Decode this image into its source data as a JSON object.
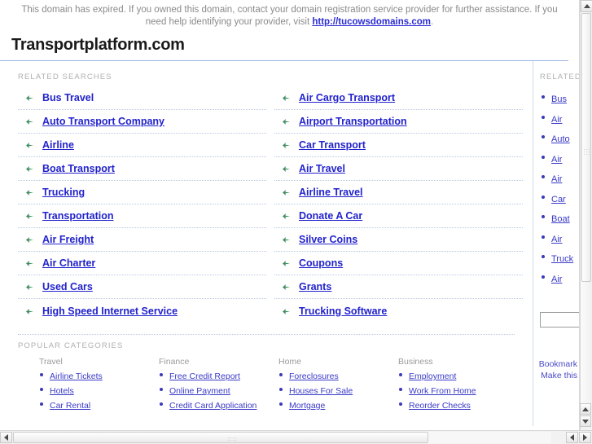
{
  "notice": {
    "text_before": "This domain has expired. If you owned this domain, contact your domain registration service provider for further assistance. If you need help identifying your provider, visit ",
    "link_text": "http://tucowsdomains.com",
    "text_after": "."
  },
  "header": {
    "domain_title": "Transportplatform.com"
  },
  "related_searches": {
    "label": "RELATED SEARCHES",
    "left_column": [
      {
        "label": "Bus Travel"
      },
      {
        "label": "Auto Transport Company"
      },
      {
        "label": "Airline"
      },
      {
        "label": "Boat Transport"
      },
      {
        "label": "Trucking"
      },
      {
        "label": "Transportation"
      },
      {
        "label": "Air Freight"
      },
      {
        "label": "Air Charter"
      },
      {
        "label": "Used Cars"
      },
      {
        "label": "High Speed Internet Service"
      }
    ],
    "right_column": [
      {
        "label": "Air Cargo Transport"
      },
      {
        "label": "Airport Transportation"
      },
      {
        "label": "Car Transport"
      },
      {
        "label": "Air Travel"
      },
      {
        "label": "Airline Travel"
      },
      {
        "label": "Donate A Car"
      },
      {
        "label": "Silver Coins"
      },
      {
        "label": "Coupons"
      },
      {
        "label": "Grants"
      },
      {
        "label": "Trucking Software"
      }
    ]
  },
  "popular_categories": {
    "label": "POPULAR CATEGORIES",
    "columns": [
      {
        "heading": "Travel",
        "items": [
          "Airline Tickets",
          "Hotels",
          "Car Rental"
        ]
      },
      {
        "heading": "Finance",
        "items": [
          "Free Credit Report",
          "Online Payment",
          "Credit Card Application"
        ]
      },
      {
        "heading": "Home",
        "items": [
          "Foreclosures",
          "Houses For Sale",
          "Mortgage"
        ]
      },
      {
        "heading": "Business",
        "items": [
          "Employment",
          "Work From Home",
          "Reorder Checks"
        ]
      }
    ]
  },
  "sidebar": {
    "label": "RELATED",
    "items": [
      {
        "label": "Bus"
      },
      {
        "label": "Air"
      },
      {
        "label": "Auto"
      },
      {
        "label": "Air"
      },
      {
        "label": "Air"
      },
      {
        "label": "Car"
      },
      {
        "label": "Boat"
      },
      {
        "label": "Air"
      },
      {
        "label": "Truck"
      },
      {
        "label": "Air"
      }
    ],
    "search_value": "",
    "footer_lines": [
      "Bookmark",
      "Make this"
    ]
  },
  "colors": {
    "link_blue": "#2222cc",
    "arrow_green": "#3f8f5f",
    "notice_gray": "#8a8a8a",
    "rule_blue": "#9fb6e8"
  }
}
